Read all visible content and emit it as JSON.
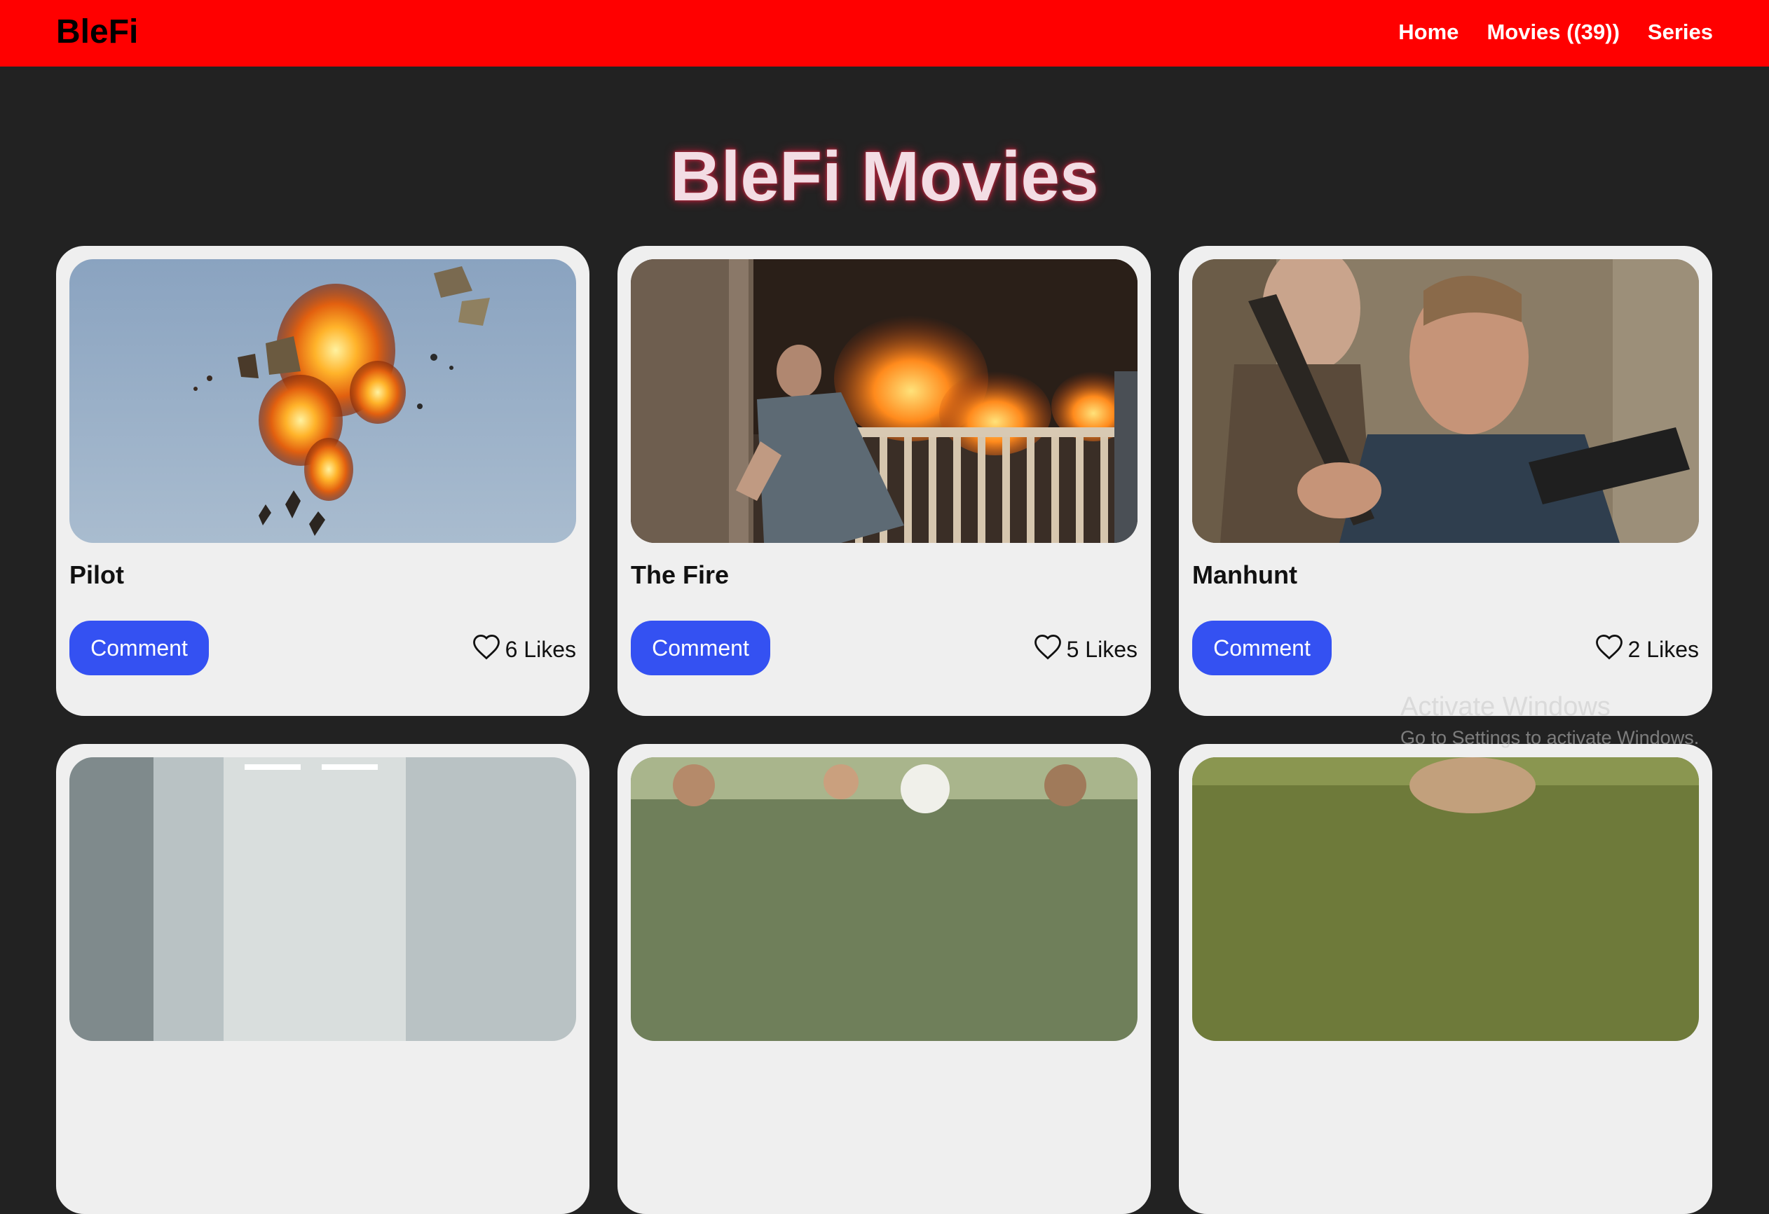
{
  "header": {
    "brand": "BleFi",
    "nav": [
      {
        "label": "Home"
      },
      {
        "label": "Movies ((39))"
      },
      {
        "label": "Series"
      }
    ],
    "background_color": "#ff0000"
  },
  "page_title": "BleFi Movies",
  "cards": [
    {
      "title": "Pilot",
      "comment_label": "Comment",
      "likes": "6 Likes",
      "image": "explosion-in-sky"
    },
    {
      "title": "The Fire",
      "comment_label": "Comment",
      "likes": "5 Likes",
      "image": "man-by-burning-porch"
    },
    {
      "title": "Manhunt",
      "comment_label": "Comment",
      "likes": "2 Likes",
      "image": "men-with-rifle-in-forest"
    },
    {
      "title": "",
      "comment_label": "",
      "likes": "",
      "image": "hospital-corridor"
    },
    {
      "title": "",
      "comment_label": "",
      "likes": "",
      "image": "crowd-outdoors"
    },
    {
      "title": "",
      "comment_label": "",
      "likes": "",
      "image": "person-in-park"
    }
  ],
  "colors": {
    "page_background": "#222222",
    "card_background": "#efefef",
    "button": "#3451f2"
  },
  "watermark": {
    "title": "Activate Windows",
    "subtitle": "Go to Settings to activate Windows."
  }
}
